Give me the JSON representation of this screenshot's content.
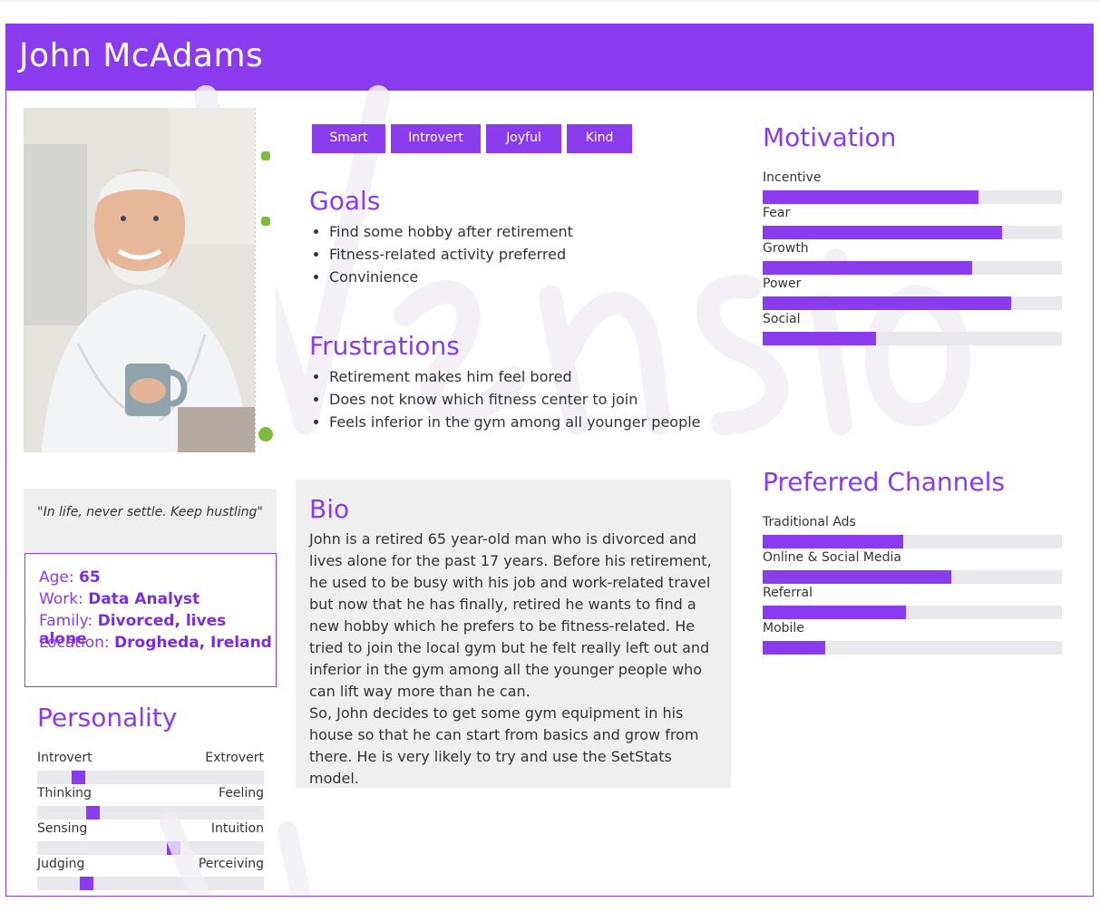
{
  "persona": {
    "name": "John McAdams",
    "quote": "\"In life, never settle. Keep hustling\"",
    "info": [
      {
        "label": "Age:",
        "value": "65"
      },
      {
        "label": "Work:",
        "value": "Data Analyst"
      },
      {
        "label": "Family:",
        "value": "Divorced, lives alone"
      },
      {
        "label": "Location:",
        "value": "Drogheda, Ireland"
      }
    ]
  },
  "traits": [
    "Smart",
    "Introvert",
    "Joyful",
    "Kind"
  ],
  "goals": {
    "title": "Goals",
    "items": [
      "Find some hobby after retirement",
      "Fitness-related activity preferred",
      "Convinience"
    ]
  },
  "frustrations": {
    "title": "Frustrations",
    "items": [
      "Retirement makes him feel bored",
      "Does not know which fitness center to join",
      "Feels inferior in the gym among all younger people"
    ]
  },
  "bio": {
    "title": "Bio",
    "paragraphs": [
      "John is a retired 65 year-old man who is divorced and lives alone for the past 17 years. Before his retirement, he used to be busy with his job and work-related travel but now that he has finally, retired he wants to find a new hobby which he prefers to be fitness-related. He tried to join the local gym but he felt really left out and inferior in the gym among all the younger people who can lift way more than he can.",
      "So, John decides to get some gym equipment in his house so that he can start from basics and grow from there. He is very likely to try and use the SetStats model."
    ]
  },
  "personality": {
    "title": "Personality",
    "scales": [
      {
        "left": "Introvert",
        "right": "Extrovert",
        "value": 0.16
      },
      {
        "left": "Thinking",
        "right": "Feeling",
        "value": 0.23
      },
      {
        "left": "Sensing",
        "right": "Intuition",
        "value": 0.61
      },
      {
        "left": "Judging",
        "right": "Perceiving",
        "value": 0.2
      }
    ]
  },
  "motivation": {
    "title": "Motivation",
    "bars": [
      {
        "label": "Incentive",
        "value": 0.72
      },
      {
        "label": "Fear",
        "value": 0.8
      },
      {
        "label": "Growth",
        "value": 0.7
      },
      {
        "label": "Power",
        "value": 0.83
      },
      {
        "label": "Social",
        "value": 0.38
      }
    ]
  },
  "channels": {
    "title": "Preferred Channels",
    "bars": [
      {
        "label": "Traditional Ads",
        "value": 0.47
      },
      {
        "label": "Online & Social Media",
        "value": 0.63
      },
      {
        "label": "Referral",
        "value": 0.48
      },
      {
        "label": "Mobile",
        "value": 0.21
      }
    ]
  },
  "colors": {
    "accent": "#8a3bee",
    "track": "#e9e8ec",
    "panel": "#efefef"
  },
  "icons": [
    "persona-photo",
    "watermark-signature"
  ]
}
